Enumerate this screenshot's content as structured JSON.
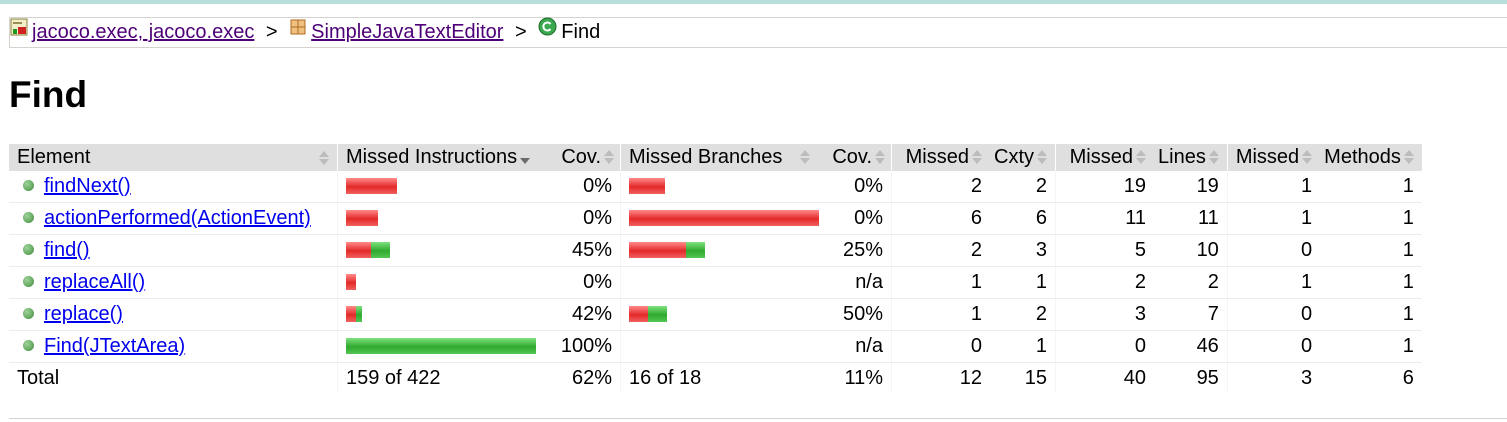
{
  "breadcrumb": {
    "report_label": "jacoco.exec, jacoco.exec",
    "package_label": "SimpleJavaTextEditor",
    "separator": ">",
    "current_label": "Find"
  },
  "title": "Find",
  "table": {
    "headers": {
      "element": "Element",
      "missed_instructions": "Missed Instructions",
      "cov_instr": "Cov.",
      "missed_branches": "Missed Branches",
      "cov_branch": "Cov.",
      "missed_cxty": "Missed",
      "cxty": "Cxty",
      "missed_lines": "Missed",
      "lines": "Lines",
      "missed_methods": "Missed",
      "methods": "Methods"
    },
    "rows": [
      {
        "name": "findNext()",
        "instr_cov": "0%",
        "branch_cov": "0%",
        "missed_cxty": "2",
        "cxty": "2",
        "missed_lines": "19",
        "lines": "19",
        "missed_methods": "1",
        "methods": "1",
        "instr_missed_frac": 0.27,
        "instr_covered_frac": 0,
        "branch_missed_frac": 0.19,
        "branch_covered_frac": 0
      },
      {
        "name": "actionPerformed(ActionEvent)",
        "instr_cov": "0%",
        "branch_cov": "0%",
        "missed_cxty": "6",
        "cxty": "6",
        "missed_lines": "11",
        "lines": "11",
        "missed_methods": "1",
        "methods": "1",
        "instr_missed_frac": 0.17,
        "instr_covered_frac": 0,
        "branch_missed_frac": 1.0,
        "branch_covered_frac": 0
      },
      {
        "name": "find()",
        "instr_cov": "45%",
        "branch_cov": "25%",
        "missed_cxty": "2",
        "cxty": "3",
        "missed_lines": "5",
        "lines": "10",
        "missed_methods": "0",
        "methods": "1",
        "instr_missed_frac": 0.13,
        "instr_covered_frac": 0.1,
        "branch_missed_frac": 0.3,
        "branch_covered_frac": 0.1
      },
      {
        "name": "replaceAll()",
        "instr_cov": "0%",
        "branch_cov": "n/a",
        "missed_cxty": "1",
        "cxty": "1",
        "missed_lines": "2",
        "lines": "2",
        "missed_methods": "1",
        "methods": "1",
        "instr_missed_frac": 0.05,
        "instr_covered_frac": 0,
        "branch_missed_frac": 0,
        "branch_covered_frac": 0
      },
      {
        "name": "replace()",
        "instr_cov": "42%",
        "branch_cov": "50%",
        "missed_cxty": "1",
        "cxty": "2",
        "missed_lines": "3",
        "lines": "7",
        "missed_methods": "0",
        "methods": "1",
        "instr_missed_frac": 0.05,
        "instr_covered_frac": 0.03,
        "branch_missed_frac": 0.1,
        "branch_covered_frac": 0.1
      },
      {
        "name": "Find(JTextArea)",
        "instr_cov": "100%",
        "branch_cov": "n/a",
        "missed_cxty": "0",
        "cxty": "1",
        "missed_lines": "0",
        "lines": "46",
        "missed_methods": "0",
        "methods": "1",
        "instr_missed_frac": 0,
        "instr_covered_frac": 1.0,
        "branch_missed_frac": 0,
        "branch_covered_frac": 0
      }
    ],
    "total": {
      "label": "Total",
      "instr": "159 of 422",
      "instr_cov": "62%",
      "branch": "16 of 18",
      "branch_cov": "11%",
      "missed_cxty": "12",
      "cxty": "15",
      "missed_lines": "40",
      "lines": "95",
      "missed_methods": "3",
      "methods": "6"
    }
  },
  "icons": {
    "report": "report-icon",
    "package": "package-icon",
    "class": "class-icon",
    "method": "method-icon"
  },
  "colors": {
    "missed": "#e32a2a",
    "covered": "#2faa2f",
    "header_bg": "#dfdfdf",
    "link": "#0000ee",
    "visited_link": "#4d0077"
  }
}
